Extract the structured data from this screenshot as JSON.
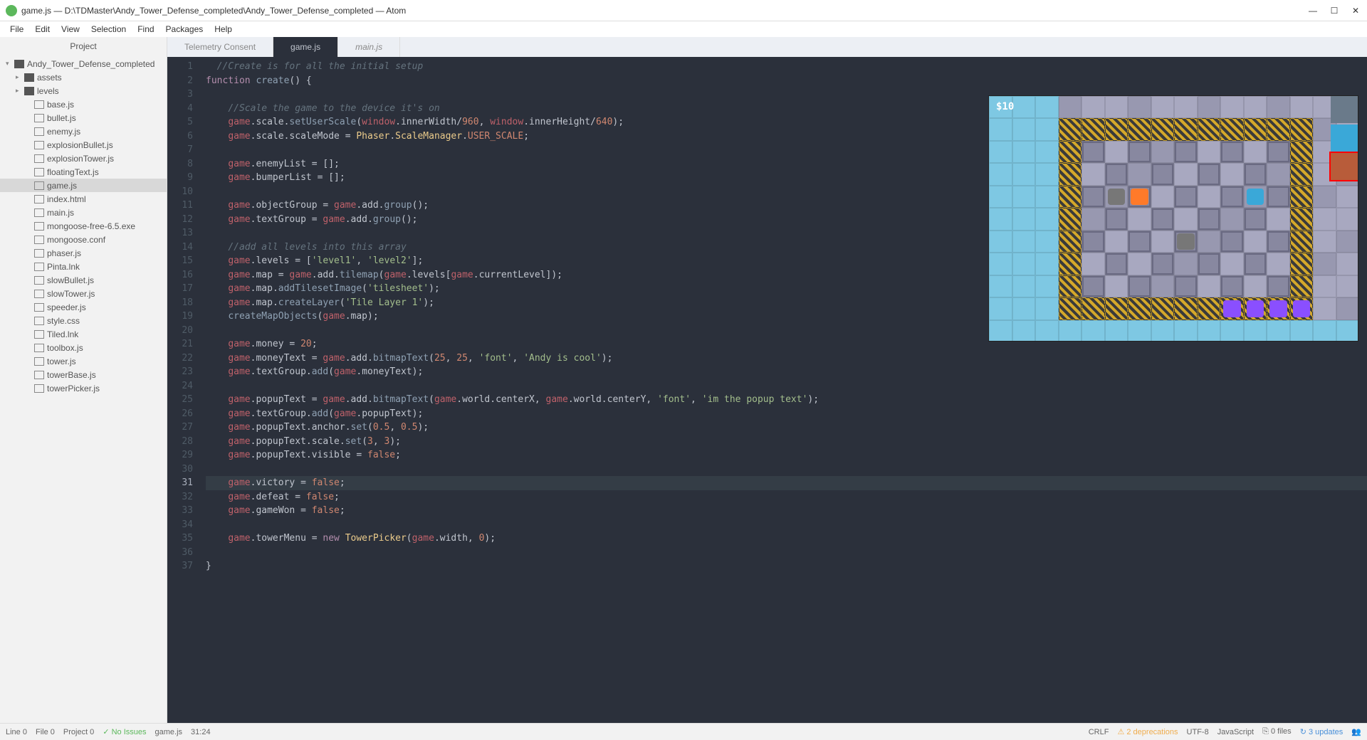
{
  "titlebar": {
    "title": "game.js — D:\\TDMaster\\Andy_Tower_Defense_completed\\Andy_Tower_Defense_completed — Atom"
  },
  "menu": [
    "File",
    "Edit",
    "View",
    "Selection",
    "Find",
    "Packages",
    "Help"
  ],
  "sidebar": {
    "header": "Project",
    "root": "Andy_Tower_Defense_completed",
    "folders": [
      "assets",
      "levels"
    ],
    "files": [
      "base.js",
      "bullet.js",
      "enemy.js",
      "explosionBullet.js",
      "explosionTower.js",
      "floatingText.js",
      "game.js",
      "index.html",
      "main.js",
      "mongoose-free-6.5.exe",
      "mongoose.conf",
      "phaser.js",
      "Pinta.lnk",
      "slowBullet.js",
      "slowTower.js",
      "speeder.js",
      "style.css",
      "Tiled.lnk",
      "toolbox.js",
      "tower.js",
      "towerBase.js",
      "towerPicker.js"
    ],
    "active": "game.js"
  },
  "tabs": [
    {
      "label": "Telemetry Consent",
      "active": false,
      "italic": false
    },
    {
      "label": "game.js",
      "active": true,
      "italic": false
    },
    {
      "label": "main.js",
      "active": false,
      "italic": true
    }
  ],
  "editor": {
    "highlighted_line": 31,
    "lines": [
      {
        "n": 1,
        "i": 1,
        "t": "comment",
        "s": "//Create is for all the initial setup"
      },
      {
        "n": 2,
        "i": 0,
        "t": "fndecl"
      },
      {
        "n": 3,
        "i": 0,
        "t": "blank"
      },
      {
        "n": 4,
        "i": 2,
        "t": "comment",
        "s": "//Scale the game to the device it's on"
      },
      {
        "n": 5,
        "i": 2,
        "t": "scale1"
      },
      {
        "n": 6,
        "i": 2,
        "t": "scale2"
      },
      {
        "n": 7,
        "i": 0,
        "t": "blank"
      },
      {
        "n": 8,
        "i": 2,
        "t": "assign_arr",
        "lhs": "enemyList"
      },
      {
        "n": 9,
        "i": 2,
        "t": "assign_arr",
        "lhs": "bumperList"
      },
      {
        "n": 10,
        "i": 0,
        "t": "blank"
      },
      {
        "n": 11,
        "i": 2,
        "t": "group",
        "lhs": "objectGroup"
      },
      {
        "n": 12,
        "i": 2,
        "t": "group",
        "lhs": "textGroup"
      },
      {
        "n": 13,
        "i": 0,
        "t": "blank"
      },
      {
        "n": 14,
        "i": 2,
        "t": "comment",
        "s": "//add all levels into this array"
      },
      {
        "n": 15,
        "i": 2,
        "t": "levels"
      },
      {
        "n": 16,
        "i": 2,
        "t": "tilemap"
      },
      {
        "n": 17,
        "i": 2,
        "t": "tileset"
      },
      {
        "n": 18,
        "i": 2,
        "t": "createlayer"
      },
      {
        "n": 19,
        "i": 2,
        "t": "createmap"
      },
      {
        "n": 20,
        "i": 0,
        "t": "blank"
      },
      {
        "n": 21,
        "i": 2,
        "t": "assign_num",
        "lhs": "money",
        "val": "20"
      },
      {
        "n": 22,
        "i": 2,
        "t": "bitmap1"
      },
      {
        "n": 23,
        "i": 2,
        "t": "tgadd",
        "arg": "moneyText"
      },
      {
        "n": 24,
        "i": 0,
        "t": "blank"
      },
      {
        "n": 25,
        "i": 2,
        "t": "bitmap2"
      },
      {
        "n": 26,
        "i": 2,
        "t": "tgadd",
        "arg": "popupText"
      },
      {
        "n": 27,
        "i": 2,
        "t": "anchorset"
      },
      {
        "n": 28,
        "i": 2,
        "t": "scaleset"
      },
      {
        "n": 29,
        "i": 2,
        "t": "assign_bool",
        "lhs": "popupText.visible",
        "val": "false"
      },
      {
        "n": 30,
        "i": 0,
        "t": "blank"
      },
      {
        "n": 31,
        "i": 2,
        "t": "assign_bool",
        "lhs": "victory",
        "val": "false"
      },
      {
        "n": 32,
        "i": 2,
        "t": "assign_bool",
        "lhs": "defeat",
        "val": "false"
      },
      {
        "n": 33,
        "i": 2,
        "t": "assign_bool",
        "lhs": "gameWon",
        "val": "false"
      },
      {
        "n": 34,
        "i": 0,
        "t": "blank"
      },
      {
        "n": 35,
        "i": 2,
        "t": "towermenu"
      },
      {
        "n": 36,
        "i": 0,
        "t": "blank"
      },
      {
        "n": 37,
        "i": 0,
        "t": "closebrace"
      }
    ]
  },
  "game": {
    "money": "$10"
  },
  "status": {
    "line": "Line 0",
    "file": "File  0",
    "project": "Project 0",
    "issues": "No Issues",
    "filename": "game.js",
    "cursor": "31:24",
    "eol": "CRLF",
    "deprecations": "2 deprecations",
    "encoding": "UTF-8",
    "lang": "JavaScript",
    "gitfiles": "0 files",
    "updates": "3 updates"
  }
}
